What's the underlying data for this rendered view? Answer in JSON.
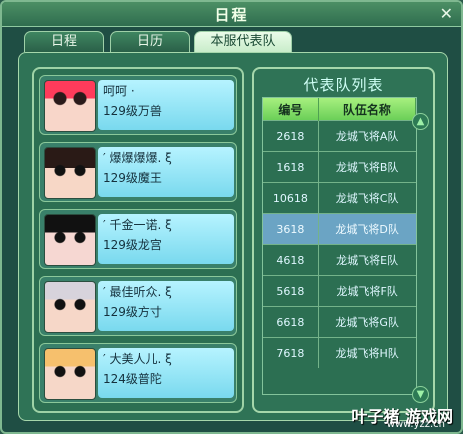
{
  "window": {
    "title": "日程"
  },
  "tabs": [
    {
      "label": "日程"
    },
    {
      "label": "日历"
    },
    {
      "label": "本服代表队"
    }
  ],
  "members": [
    {
      "name": "呵呵 ·",
      "level": "129级万兽"
    },
    {
      "name": "′ 爆爆爆爆. ξ",
      "level": "129级魔王"
    },
    {
      "name": "′ 千金一诺. ξ",
      "level": "129级龙宫"
    },
    {
      "name": "′ 最佳听众. ξ",
      "level": "129级方寸"
    },
    {
      "name": "′ 大美人儿. ξ",
      "level": "124级普陀"
    }
  ],
  "team_list": {
    "title": "代表队列表",
    "columns": [
      "编号",
      "队伍名称"
    ],
    "rows": [
      [
        "2618",
        "龙城飞将A队"
      ],
      [
        "1618",
        "龙城飞将B队"
      ],
      [
        "10618",
        "龙城飞将C队"
      ],
      [
        "3618",
        "龙城飞将D队"
      ],
      [
        "4618",
        "龙城飞将E队"
      ],
      [
        "5618",
        "龙城飞将F队"
      ],
      [
        "6618",
        "龙城飞将G队"
      ],
      [
        "7618",
        "龙城飞将H队"
      ]
    ]
  },
  "watermark": {
    "text": "叶子猪 游戏网",
    "url": "www.yzz.cn"
  }
}
